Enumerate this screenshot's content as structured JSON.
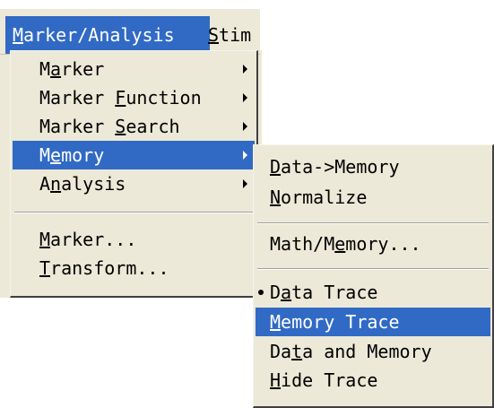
{
  "menubar": {
    "items": [
      {
        "label": "Marker/Analysis",
        "mnemonic_index": 0,
        "active": true
      },
      {
        "label": "Stim",
        "mnemonic_index": 0,
        "active": false
      }
    ]
  },
  "main_menu": {
    "items": [
      {
        "label": "Marker",
        "mnemonic_index": 1,
        "submenu": true
      },
      {
        "label": "Marker Function",
        "mnemonic_index": 7,
        "submenu": true
      },
      {
        "label": "Marker Search",
        "mnemonic_index": 7,
        "submenu": true
      },
      {
        "label": "Memory",
        "mnemonic_index": 1,
        "submenu": true,
        "highlighted": true
      },
      {
        "label": "Analysis",
        "mnemonic_index": 1,
        "submenu": true
      },
      {
        "label": "Marker...",
        "mnemonic_index": 0,
        "submenu": false
      },
      {
        "label": "Transform...",
        "mnemonic_index": 0,
        "submenu": false
      }
    ]
  },
  "memory_submenu": {
    "items": [
      {
        "label": "Data->Memory",
        "mnemonic_index": 0
      },
      {
        "label": "Normalize",
        "mnemonic_index": 0
      },
      {
        "label": "Math/Memory...",
        "mnemonic_index": 6
      },
      {
        "label": "Data Trace",
        "mnemonic_index": 1,
        "checked": true
      },
      {
        "label": "Memory Trace",
        "mnemonic_index": 0,
        "highlighted": true
      },
      {
        "label": "Data and Memory",
        "mnemonic_index": 2
      },
      {
        "label": "Hide Trace",
        "mnemonic_index": 0
      }
    ]
  },
  "colors": {
    "menu_bg": "#ece9d8",
    "highlight_bg": "#316ac5",
    "highlight_fg": "#ffffff",
    "text": "#000000"
  }
}
